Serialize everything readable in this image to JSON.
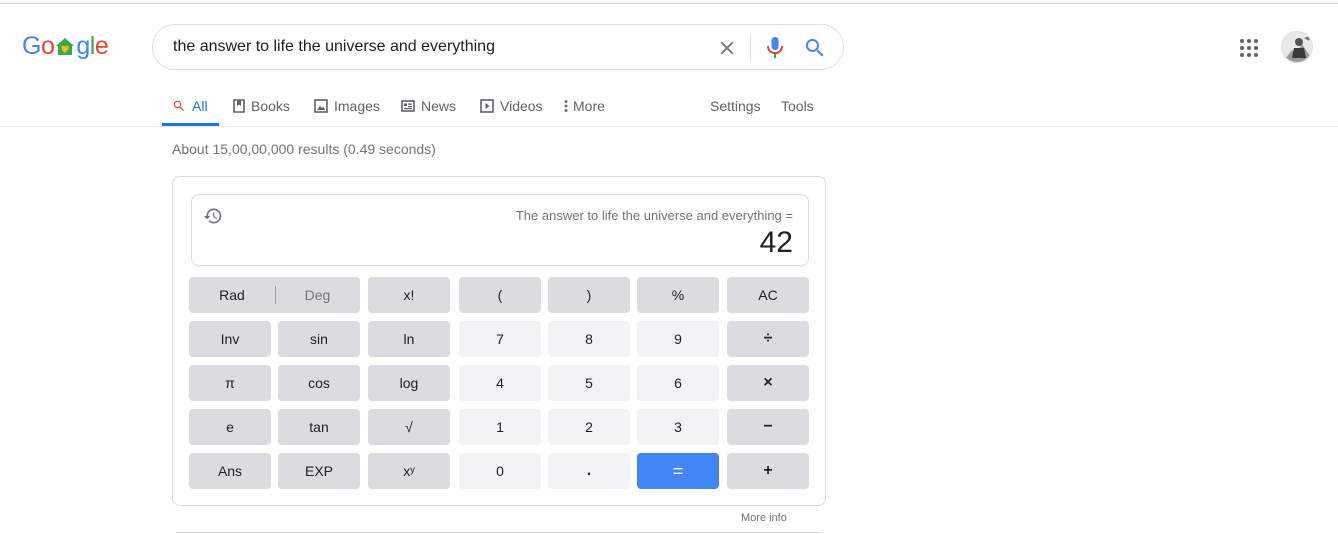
{
  "logo": {
    "text": "Google",
    "letters": [
      {
        "ch": "G",
        "color": "#4285f4"
      },
      {
        "ch": "o",
        "color": "#ea4335"
      },
      {
        "ch": "g",
        "color": "#4285f4"
      },
      {
        "ch": "l",
        "color": "#34a853"
      },
      {
        "ch": "e",
        "color": "#ea4335"
      }
    ],
    "doodle_colors": [
      "#34a853",
      "#fbbc05"
    ]
  },
  "search": {
    "query": "the answer to life the universe and everything",
    "icons": [
      "close-icon",
      "mic-icon",
      "search-icon"
    ]
  },
  "header_icons": [
    "apps-grid-icon",
    "avatar"
  ],
  "tabs": [
    {
      "label": "All",
      "icon": "search-icon",
      "active": true
    },
    {
      "label": "Books",
      "icon": "book-icon",
      "active": false
    },
    {
      "label": "Images",
      "icon": "image-icon",
      "active": false
    },
    {
      "label": "News",
      "icon": "news-icon",
      "active": false
    },
    {
      "label": "Videos",
      "icon": "video-icon",
      "active": false
    },
    {
      "label": "More",
      "icon": "more-vert-icon",
      "active": false
    }
  ],
  "tools": {
    "settings": "Settings",
    "tools": "Tools"
  },
  "result_stats": "About 15,00,00,000 results (0.49 seconds)",
  "calculator": {
    "expression": "The answer to life the universe and everything =",
    "result": "42",
    "mode": {
      "rad": "Rad",
      "deg": "Deg",
      "selected": "Rad"
    },
    "rows": [
      [
        "x!",
        "(",
        ")",
        "%",
        "AC"
      ],
      [
        "Inv",
        "sin",
        "ln",
        "7",
        "8",
        "9",
        "÷"
      ],
      [
        "π",
        "cos",
        "log",
        "4",
        "5",
        "6",
        "×"
      ],
      [
        "e",
        "tan",
        "√",
        "1",
        "2",
        "3",
        "−"
      ],
      [
        "Ans",
        "EXP",
        "xʸ",
        "0",
        ".",
        "=",
        "+"
      ]
    ]
  },
  "more_info": "More info",
  "colors": {
    "accent": "#1a73e8",
    "equals_key": "#4285f4",
    "fn_key": "#dadce0",
    "num_key": "#f1f3f4"
  }
}
